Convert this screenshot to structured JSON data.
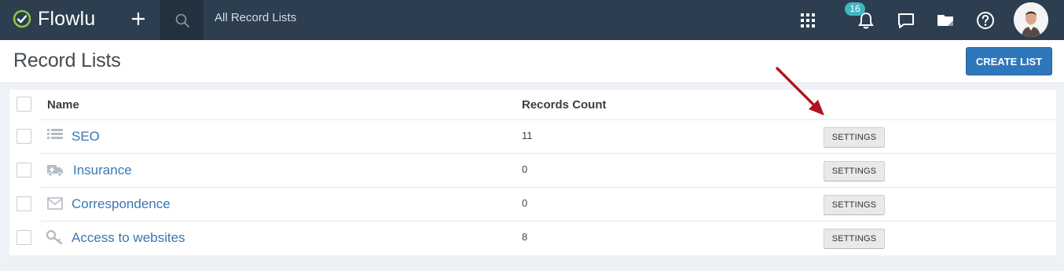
{
  "app": {
    "name": "Flowlu",
    "breadcrumb": "All Record Lists",
    "notifications_count": "16"
  },
  "topbar_icons": [
    "apps-grid-icon",
    "bell-icon",
    "chat-icon",
    "folder-icon",
    "help-icon"
  ],
  "page": {
    "title": "Record Lists",
    "create_button": "CREATE LIST"
  },
  "table": {
    "columns": {
      "name": "Name",
      "count": "Records Count"
    },
    "rows": [
      {
        "name": "SEO",
        "icon": "list-icon",
        "count": "11",
        "action": "SETTINGS"
      },
      {
        "name": "Insurance",
        "icon": "ambulance-icon",
        "count": "0",
        "action": "SETTINGS"
      },
      {
        "name": "Correspondence",
        "icon": "envelope-icon",
        "count": "0",
        "action": "SETTINGS"
      },
      {
        "name": "Access to websites",
        "icon": "key-icon",
        "count": "8",
        "action": "SETTINGS"
      }
    ]
  },
  "colors": {
    "topbar": "#2c3e50",
    "accent": "#2e77bb",
    "link": "#3a76b3",
    "badge": "#3fb6c4",
    "annotation_arrow": "#b0141f"
  }
}
